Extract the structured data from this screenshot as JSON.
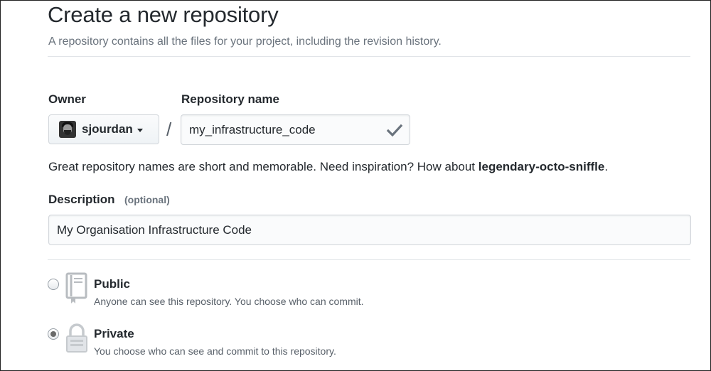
{
  "header": {
    "title": "Create a new repository",
    "subtitle": "A repository contains all the files for your project, including the revision history."
  },
  "owner": {
    "label": "Owner",
    "value": "sjourdan"
  },
  "separator": "/",
  "repository_name": {
    "label": "Repository name",
    "value": "my_infrastructure_code",
    "valid_icon": "check-icon"
  },
  "hint": {
    "text": "Great repository names are short and memorable. Need inspiration? How about",
    "suggestion": "legendary-octo-sniffle",
    "end": "."
  },
  "description": {
    "label": "Description",
    "optional": "(optional)",
    "value": "My Organisation Infrastructure Code"
  },
  "visibility": {
    "selected": "private",
    "options": [
      {
        "id": "public",
        "title": "Public",
        "description": "Anyone can see this repository. You choose who can commit.",
        "icon": "repo-book-icon"
      },
      {
        "id": "private",
        "title": "Private",
        "description": "You choose who can see and commit to this repository.",
        "icon": "lock-icon"
      }
    ]
  },
  "colors": {
    "text": "#24292e",
    "muted": "#6a737d",
    "border": "#d1d5da"
  }
}
